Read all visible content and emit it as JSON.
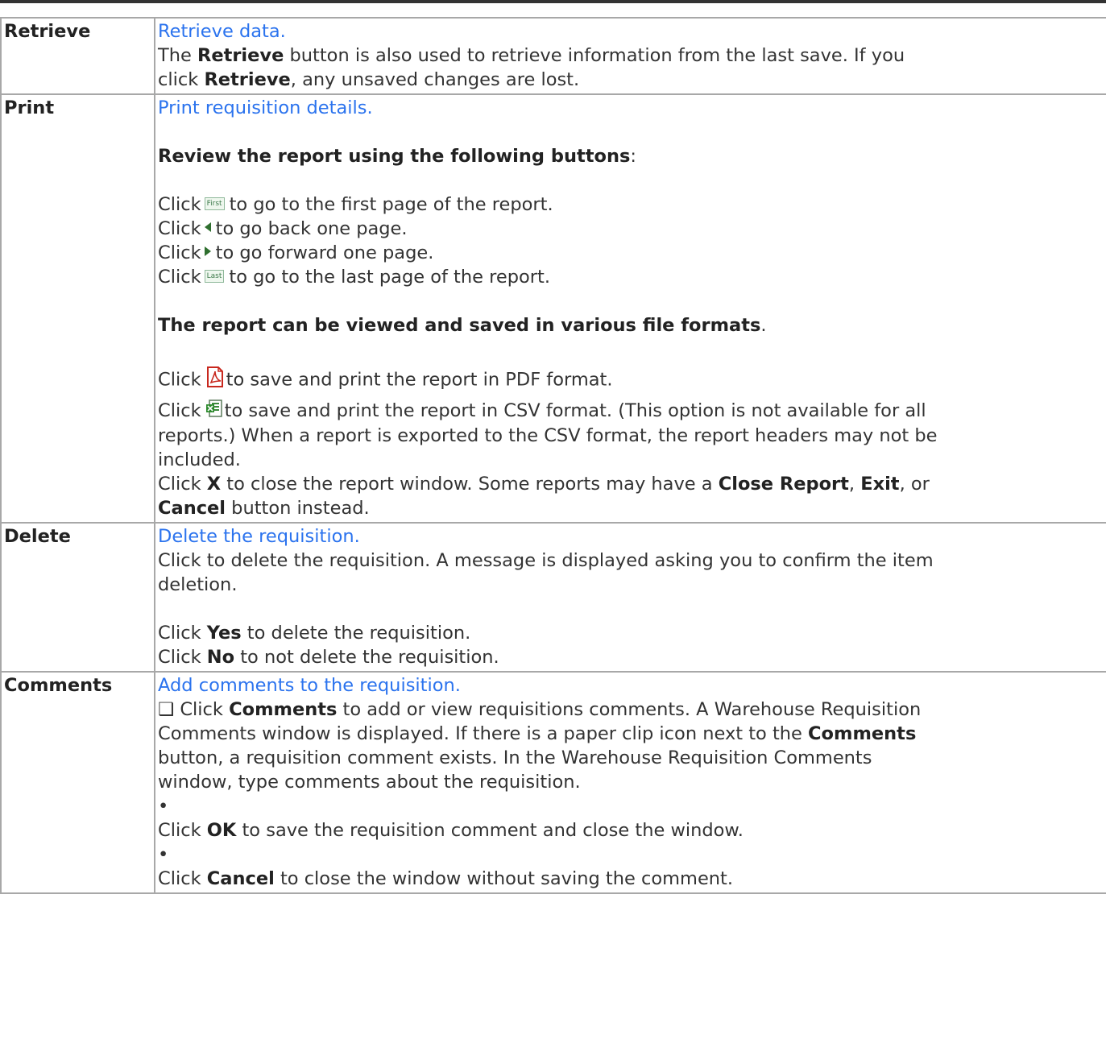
{
  "rows": [
    {
      "label": "Retrieve",
      "link": "Retrieve data.",
      "line1_pre": "The ",
      "line1_bold": "Retrieve",
      "line1_post": " button is also used to retrieve information from the last save. If you",
      "line2_pre": "click ",
      "line2_bold": "Retrieve",
      "line2_post": ", any unsaved changes are lost."
    },
    {
      "label": "Print",
      "link": "Print requisition details.",
      "review_heading": "Review the report using the following buttons",
      "review_colon": ":",
      "click": "Click",
      "first_btn": "First",
      "first_text": "to go to the first page of the report.",
      "prev_icon": "left-triangle-icon",
      "prev_text": "to go back one page.",
      "next_icon": "right-triangle-icon",
      "next_text": "to go forward one page.",
      "last_btn": "Last",
      "last_text": "to go to the last page of the report.",
      "formats_heading": "The report can be viewed and saved in various file formats",
      "formats_period": ".",
      "pdf_icon": "pdf-icon",
      "pdf_text": "to save and print the report in PDF format.",
      "csv_icon": "csv-spreadsheet-icon",
      "csv_line1": "to save and print the report in CSV format. (This option is not available for all",
      "csv_line2": "reports.) When a report is exported to the CSV format, the report headers may not be",
      "csv_line3": "included.",
      "close_bold_x": "X",
      "close_text": " to close the report window. Some reports may have a ",
      "close_report": "Close Report",
      "comma1": ", ",
      "exit": "Exit",
      "or": ", or",
      "cancel": "Cancel",
      "cancel_post": " button instead."
    },
    {
      "label": "Delete",
      "link": "Delete the requisition.",
      "line1": "Click to delete the requisition. A message is displayed asking you to confirm the item",
      "line2": "deletion.",
      "yes_pre": "Click ",
      "yes": "Yes",
      "yes_post": " to delete the requisition.",
      "no_pre": "Click ",
      "no": "No",
      "no_post": " to not delete the requisition."
    },
    {
      "label": "Comments",
      "link": "Add comments to the requisition.",
      "l1_pre": "❑ Click ",
      "l1_bold": "Comments",
      "l1_post": " to add or view requisitions comments. A Warehouse Requisition",
      "l2_pre": "Comments window is displayed. If there is a paper clip icon next to the ",
      "l2_bold": "Comments",
      "l3": "button, a requisition comment exists. In the Warehouse Requisition Comments",
      "l4": "window, type comments about the requisition.",
      "bullet": "•",
      "ok_pre": "Click ",
      "ok": "OK",
      "ok_post": " to save the requisition comment and close the window.",
      "cancel_pre": "Click ",
      "cancel": "Cancel",
      "cancel_post": " to close the window without saving the comment."
    }
  ]
}
